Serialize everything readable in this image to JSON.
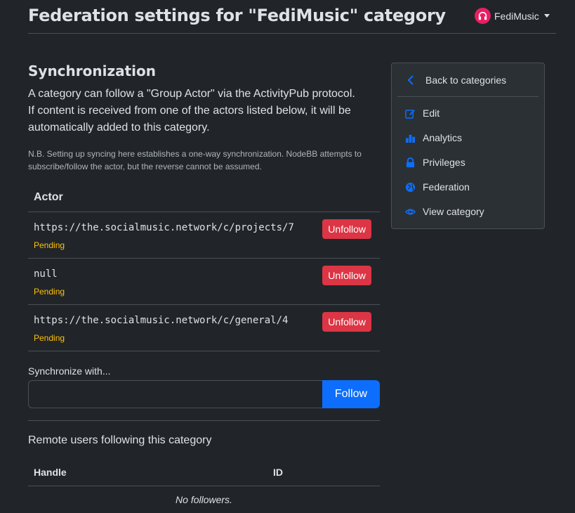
{
  "header": {
    "title": "Federation settings for \"FediMusic\" category",
    "category_switch": {
      "label": "FediMusic",
      "icon": "headphones-icon",
      "color": "#e91e63"
    }
  },
  "sync": {
    "title": "Synchronization",
    "lead": "A category can follow a \"Group Actor\" via the ActivityPub protocol. If content is received from one of the actors listed below, it will be automatically added to this category.",
    "note": "N.B. Setting up syncing here establishes a one-way synchronization. NodeBB attempts to subscribe/follow the actor, but the reverse cannot be assumed.",
    "table_header": "Actor",
    "actors": [
      {
        "id": "https://the.socialmusic.network/c/projects/7",
        "status": "Pending",
        "action": "Unfollow"
      },
      {
        "id": "null",
        "status": "Pending",
        "action": "Unfollow"
      },
      {
        "id": "https://the.socialmusic.network/c/general/4",
        "status": "Pending",
        "action": "Unfollow"
      }
    ],
    "input_label": "Synchronize with...",
    "input_value": "",
    "follow_label": "Follow"
  },
  "followers": {
    "title": "Remote users following this category",
    "columns": [
      "Handle",
      "ID"
    ],
    "empty": "No followers."
  },
  "sidebar": {
    "back": "Back to categories",
    "items": [
      {
        "label": "Edit",
        "icon": "edit-icon"
      },
      {
        "label": "Analytics",
        "icon": "analytics-icon"
      },
      {
        "label": "Privileges",
        "icon": "lock-icon"
      },
      {
        "label": "Federation",
        "icon": "globe-icon"
      },
      {
        "label": "View category",
        "icon": "eye-icon"
      }
    ]
  },
  "colors": {
    "background": "#212529",
    "accent": "#0d6efd",
    "danger": "#dc3545",
    "warning": "#ffc107"
  }
}
